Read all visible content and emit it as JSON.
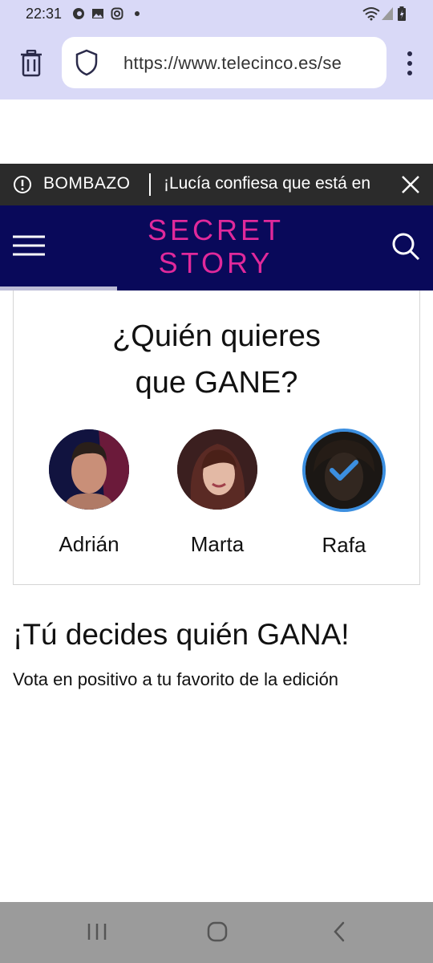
{
  "status_bar": {
    "time": "22:31",
    "left_icons": [
      "firefox-icon",
      "gallery-icon",
      "instagram-icon",
      "dot-icon"
    ],
    "right_icons": [
      "wifi-icon",
      "signal-icon",
      "battery-icon"
    ]
  },
  "browser": {
    "url": "https://www.telecinco.es/se",
    "icons": [
      "trash-icon",
      "shield-icon",
      "more-vertical-icon"
    ]
  },
  "breaking": {
    "label": "BOMBAZO",
    "text": "¡Lucía confiesa que está en",
    "icons": [
      "alert-circle-icon",
      "close-icon"
    ]
  },
  "header": {
    "logo_line1": "SECRET",
    "logo_line2": "STORY",
    "logo_color": "#e0299b",
    "background": "#09095a",
    "icons": [
      "menu-icon",
      "search-icon"
    ]
  },
  "poll": {
    "title_line1": "¿Quién quieres",
    "title_line2": "que GANE?",
    "candidates": [
      {
        "name": "Adrián",
        "selected": false
      },
      {
        "name": "Marta",
        "selected": false
      },
      {
        "name": "Rafa",
        "selected": true
      }
    ],
    "selected_color": "#3c8fe0"
  },
  "section": {
    "title": "¡Tú decides quién GANA!",
    "subtitle": "Vota en positivo a tu favorito de la edición"
  },
  "nav_bar": {
    "icons": [
      "recents-icon",
      "home-icon",
      "back-icon"
    ]
  }
}
